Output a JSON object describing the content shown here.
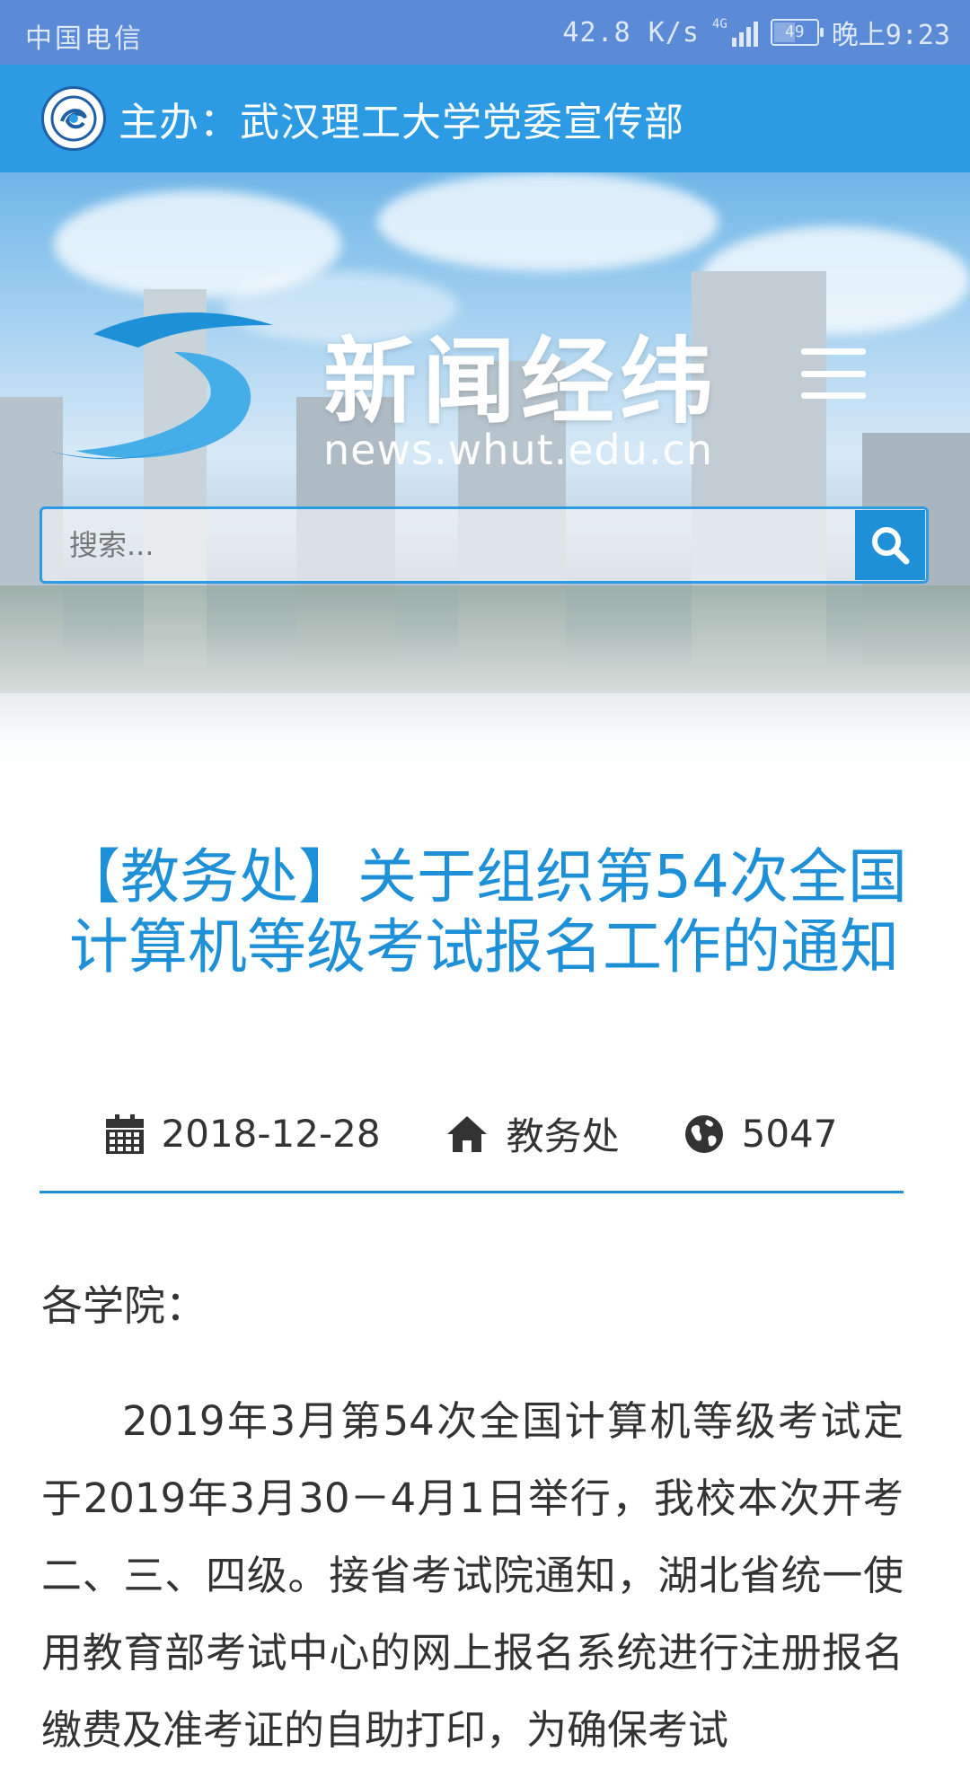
{
  "status_bar": {
    "carrier": "中国电信",
    "network_speed": "42.8 K/s",
    "network_type": "4G",
    "battery": "49",
    "time": "晚上9:23"
  },
  "host_bar": {
    "text": "主办：武汉理工大学党委宣传部"
  },
  "hero": {
    "brand_title": "新闻经纬",
    "brand_url": "news.whut.edu.cn",
    "search_placeholder": "搜索..."
  },
  "article": {
    "title": "【教务处】关于组织第54次全国计算机等级考试报名工作的通知",
    "meta": {
      "date": "2018-12-28",
      "department": "教务处",
      "views": "5047"
    },
    "salutation": "各学院：",
    "body": "2019年3月第54次全国计算机等级考试定于2019年3月30－4月1日举行，我校本次开考二、三、四级。接省考试院通知，湖北省统一使用教育部考试中心的网上报名系统进行注册报名缴费及准考证的自助打印，为确保考试"
  },
  "colors": {
    "status_bar": "#5b8ad6",
    "host_bar": "#2d9be3",
    "accent": "#1e90d8",
    "text": "#333333"
  },
  "icons": {
    "menu": "hamburger-icon",
    "search": "search-icon",
    "date": "calendar-icon",
    "department": "home-icon",
    "views": "globe-icon"
  }
}
